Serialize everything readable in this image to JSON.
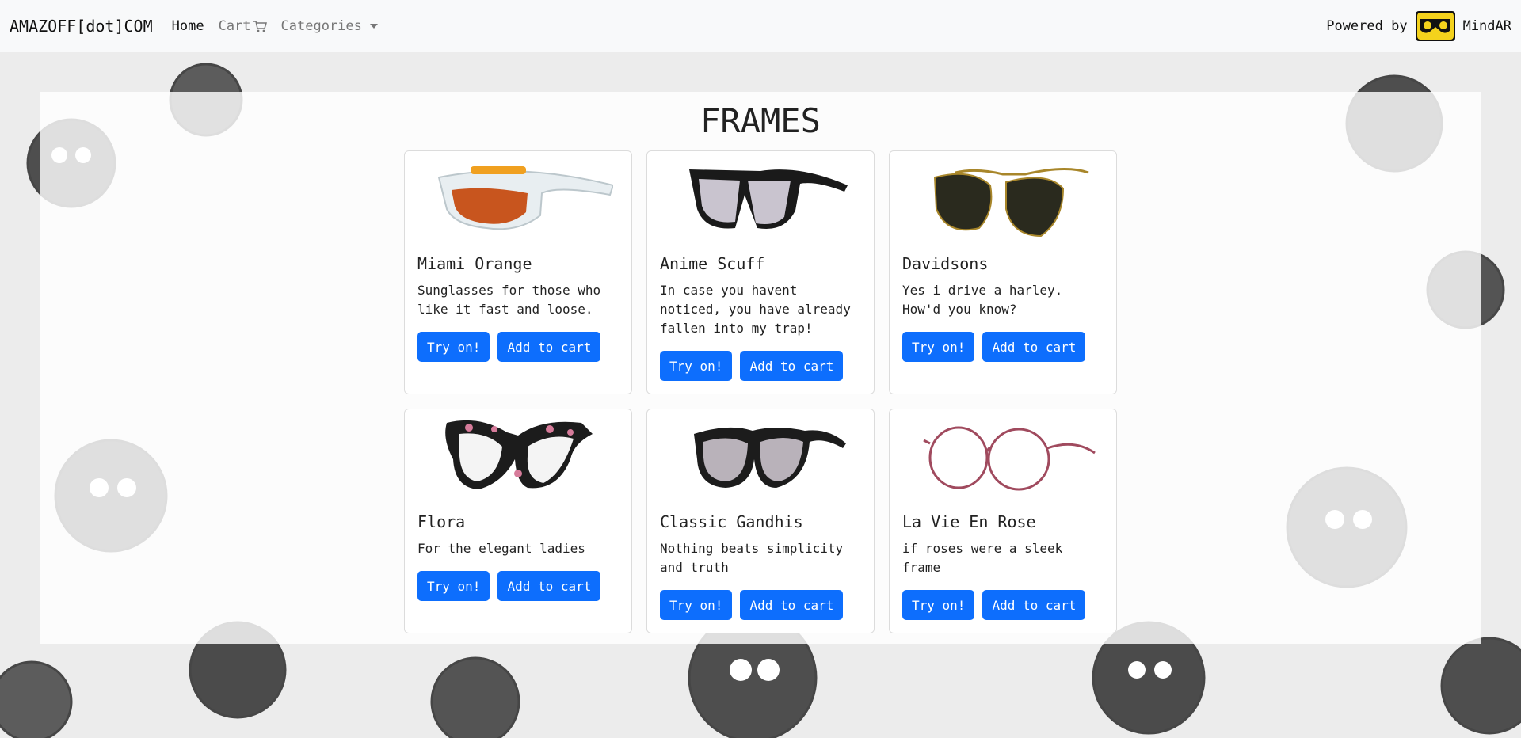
{
  "navbar": {
    "brand": "AMAZOFF[dot]COM",
    "links": [
      {
        "label": "Home"
      },
      {
        "label": "Cart"
      },
      {
        "label": "Categories"
      }
    ],
    "powered_by": "Powered by",
    "powered_name": "MindAR"
  },
  "page": {
    "title": "FRAMES"
  },
  "products": [
    {
      "name": "Miami Orange",
      "description": "Sunglasses for those who like it fast and loose.",
      "try_label": "Try on!",
      "cart_label": "Add to cart",
      "image": "white-orange-sunglasses"
    },
    {
      "name": "Anime Scuff",
      "description": "In case you havent noticed, you have already fallen into my trap!",
      "try_label": "Try on!",
      "cart_label": "Add to cart",
      "image": "black-square-sunglasses"
    },
    {
      "name": "Davidsons",
      "description": "Yes i drive a harley. How'd you know?",
      "try_label": "Try on!",
      "cart_label": "Add to cart",
      "image": "gold-aviator-sunglasses"
    },
    {
      "name": "Flora",
      "description": "For the elegant ladies",
      "try_label": "Try on!",
      "cart_label": "Add to cart",
      "image": "floral-cat-eye-glasses"
    },
    {
      "name": "Classic Gandhis",
      "description": "Nothing beats simplicity and truth",
      "try_label": "Try on!",
      "cart_label": "Add to cart",
      "image": "black-round-sunglasses"
    },
    {
      "name": "La Vie En Rose",
      "description": "if roses were a sleek frame",
      "try_label": "Try on!",
      "cart_label": "Add to cart",
      "image": "rose-wire-glasses"
    }
  ],
  "colors": {
    "primary": "#0d6efd",
    "navbar_bg": "#f8f9fa"
  }
}
